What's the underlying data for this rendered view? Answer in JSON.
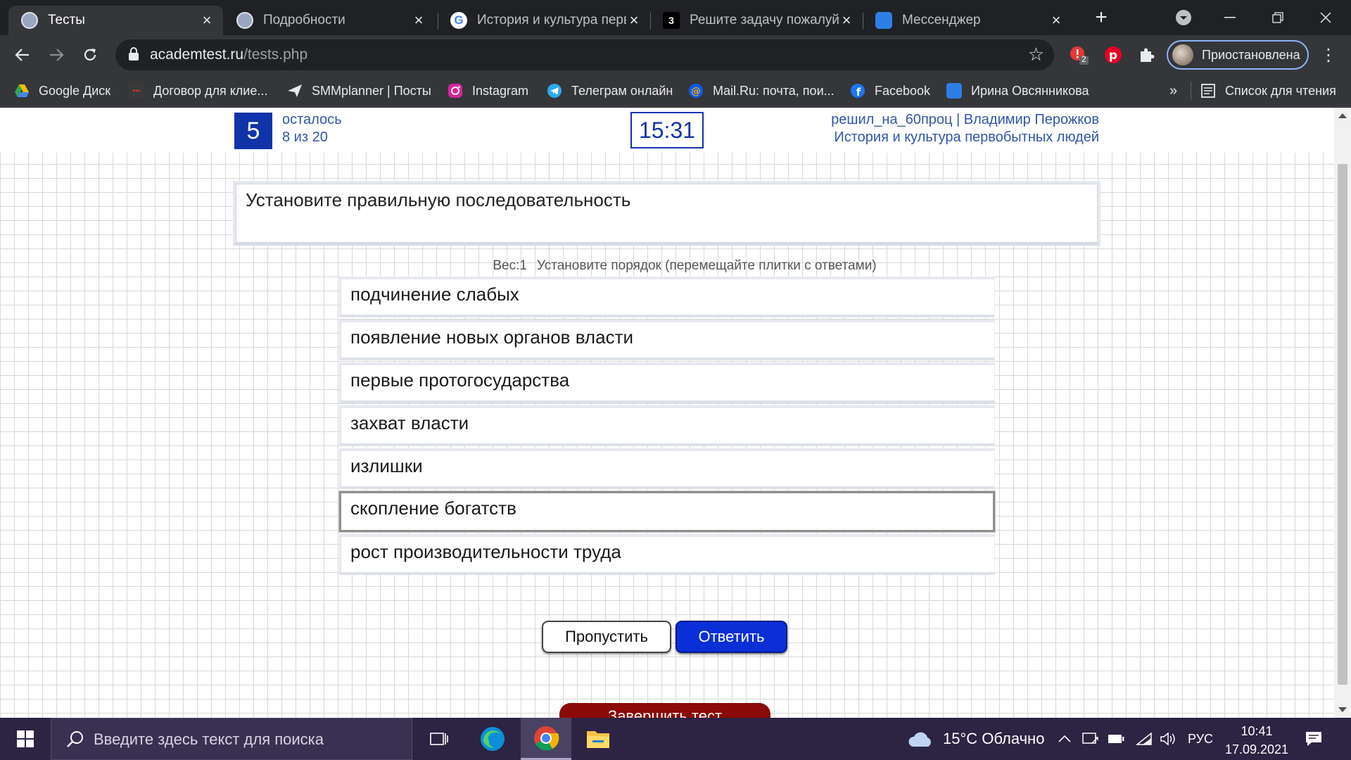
{
  "tabs": [
    {
      "title": "Тесты",
      "active": true
    },
    {
      "title": "Подробности",
      "active": false
    },
    {
      "title": "История и культура перв",
      "active": false
    },
    {
      "title": "Решите задачу пожалуйс",
      "active": false
    },
    {
      "title": "Мессенджер",
      "active": false
    }
  ],
  "toolbar": {
    "url_host": "academtest.ru",
    "url_path": "/tests.php",
    "profile_label": "Приостановлена",
    "extension_badge": "2"
  },
  "bookmarks": [
    "Google Диск",
    "Договор для клие...",
    "SMMplanner | Посты",
    "Instagram",
    "Телеграм онлайн",
    "Mail.Ru: почта, пои...",
    "Facebook",
    "Ирина Овсянникова"
  ],
  "bookmarks_overflow": "»",
  "reading_list": "Список для чтения",
  "test": {
    "question_number": "5",
    "remaining_label": "осталось",
    "remaining_value": "8 из 20",
    "timer": "15:31",
    "user_line": "решил_на_60проц | Владимир Перожков",
    "subject": "История и культура первобытных людей",
    "question": "Установите правильную последовательность",
    "weight": "Вес:1",
    "instruction": "Установите порядок (перемещайте плитки с ответами)",
    "tiles": [
      "подчинение слабых",
      "появление новых органов власти",
      "первые протогосударства",
      "захват власти",
      "излишки",
      "скопление богатств",
      "рост производительности труда"
    ],
    "selected_tile": 5,
    "skip_label": "Пропустить",
    "answer_label": "Ответить",
    "finish_label": "Завершить тест"
  },
  "taskbar": {
    "search_placeholder": "Введите здесь текст для поиска",
    "weather": "15°C Облачно",
    "language": "РУС",
    "time": "10:41",
    "date": "17.09.2021"
  },
  "colors": {
    "accent_blue": "#1133aa",
    "answer_button": "#0a2fd6",
    "finish_button": "#8b0a0a",
    "link_text": "#3355aa"
  }
}
